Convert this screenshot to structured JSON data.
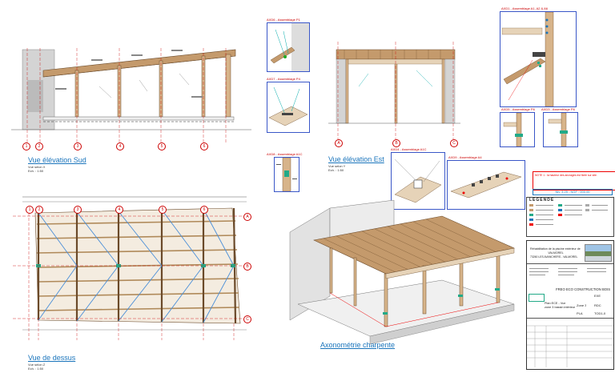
{
  "views": {
    "south": {
      "title": "Vue élévation Sud",
      "ref": "Vue selon X",
      "scale": "Ech. : 1:50"
    },
    "east": {
      "title": "Vue élévation Est",
      "ref": "Vue selon Y",
      "scale": "Ech. : 1:50"
    },
    "top": {
      "title": "Vue de dessus",
      "ref": "Vue selon Z",
      "scale": "Ech. : 1:50"
    },
    "axo": {
      "title": "Axonométrie charpente"
    }
  },
  "details": {
    "d1": "AXD6 - Assemblage P1",
    "d2": "AXD7 - Assemblage P4",
    "d3": "AXD8 - Assemblage A1C",
    "d4": "AXD1 - Assemblage A1, A2 & A6",
    "d5": "AXD5 - Assemblage P6",
    "d6": "AXD3 - Assemblage P6",
    "d7": "AXD4 - Assemblage A1C",
    "d8": "AXD9 - Assemblage A4"
  },
  "grid_south": [
    "1",
    "2",
    "3",
    "4",
    "5",
    "6"
  ],
  "grid_east": [
    "A",
    "B",
    "C"
  ],
  "grid_top": [
    "1",
    "2",
    "3",
    "4",
    "5",
    "6"
  ],
  "grid_top_side": [
    "A",
    "B",
    "C"
  ],
  "note_red": "NOTE 1 : la hauteur des ancrages est fixée sur site.",
  "level_box": "Niv. 3.25 - NGF : 000.00",
  "legend": {
    "title": "LEGENDE"
  },
  "cartouche": {
    "project_line1": "Réhabilitation de la piscine extérieur de",
    "project_line2": "VALMOREL",
    "project_line3": "73260 LES AVANCHERS - VALMOREL",
    "company": "FREO ECO CONSTRUCTION BOIS",
    "drawing_line1": "Plan ECE - Vue",
    "drawing_line2": "zone 3 bassin intérieur",
    "codes": [
      "EXE",
      "RDC",
      "TOD1-0"
    ],
    "zone": "Zone 3",
    "type": "PLA"
  },
  "colors": {
    "accent_blue": "#1b75bc",
    "grid_red": "#cc0000",
    "detail_border": "#3a57c8",
    "timber": "#b08a5a"
  }
}
